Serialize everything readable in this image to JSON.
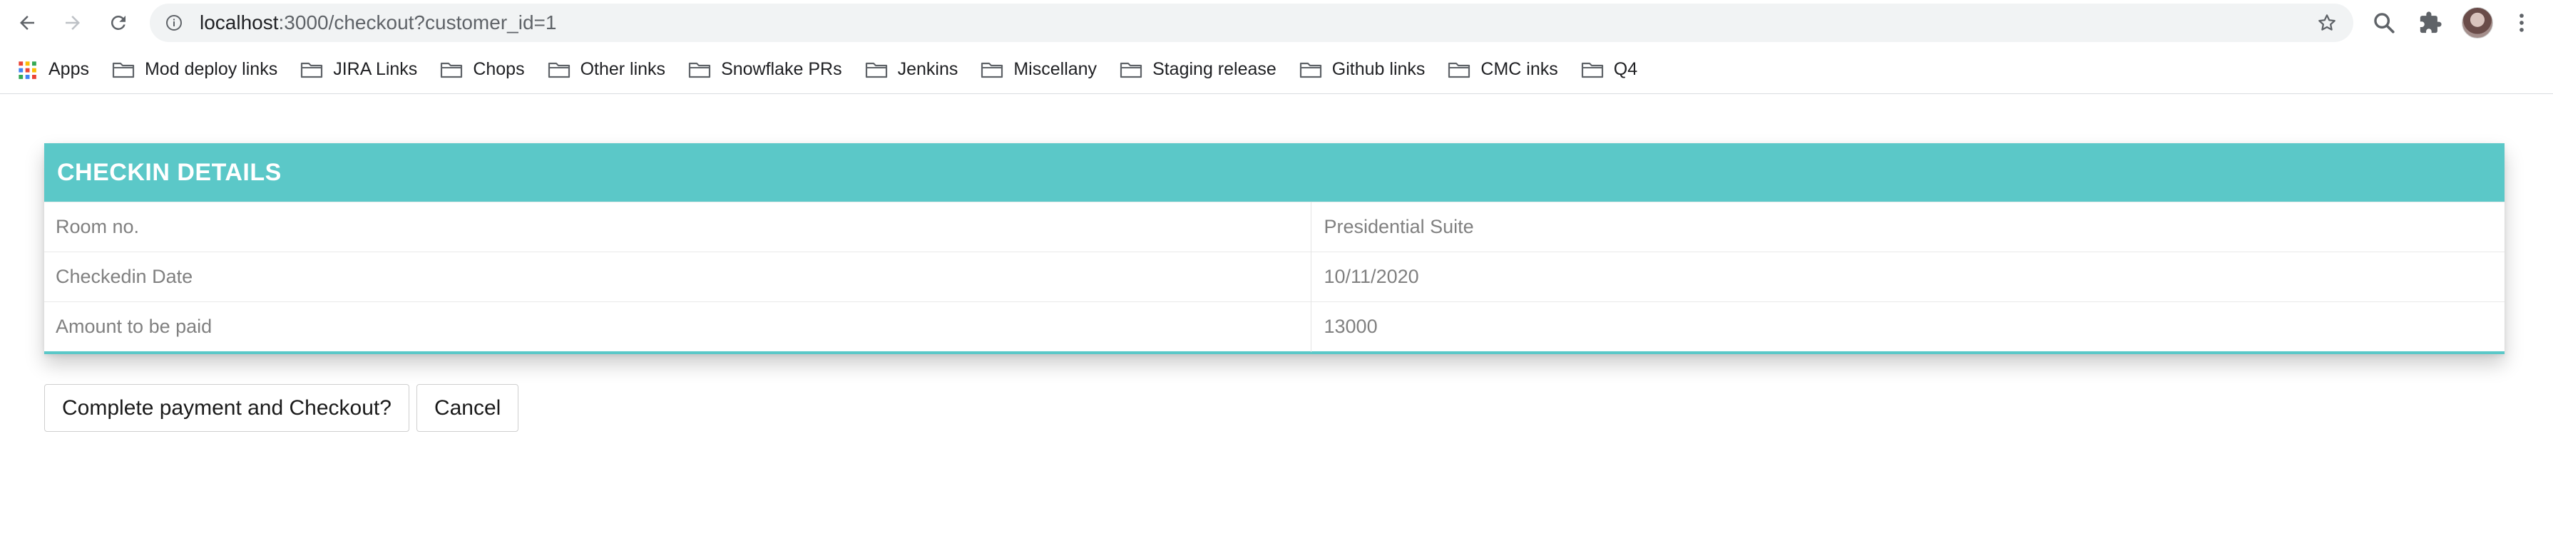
{
  "browser": {
    "url_host": "localhost",
    "url_rest": ":3000/checkout?customer_id=1"
  },
  "bookmarks": [
    {
      "label": "Apps",
      "icon": "apps-grid-icon"
    },
    {
      "label": "Mod deploy links",
      "icon": "folder-icon"
    },
    {
      "label": "JIRA Links",
      "icon": "folder-icon"
    },
    {
      "label": "Chops",
      "icon": "folder-icon"
    },
    {
      "label": "Other links",
      "icon": "folder-icon"
    },
    {
      "label": "Snowflake PRs",
      "icon": "folder-icon"
    },
    {
      "label": "Jenkins",
      "icon": "folder-icon"
    },
    {
      "label": "Miscellany",
      "icon": "folder-icon"
    },
    {
      "label": "Staging release",
      "icon": "folder-icon"
    },
    {
      "label": "Github links",
      "icon": "folder-icon"
    },
    {
      "label": "CMC inks",
      "icon": "folder-icon"
    },
    {
      "label": "Q4",
      "icon": "folder-icon"
    }
  ],
  "checkin": {
    "title": "CHECKIN DETAILS",
    "rows": [
      {
        "label": "Room no.",
        "value": "Presidential Suite"
      },
      {
        "label": "Checkedin Date",
        "value": "10/11/2020"
      },
      {
        "label": "Amount to be paid",
        "value": "13000"
      }
    ]
  },
  "actions": {
    "checkout_label": "Complete payment and Checkout?",
    "cancel_label": "Cancel"
  },
  "colors": {
    "accent": "#5bc8c8",
    "header_text": "#ffffff",
    "cell_text": "#808080"
  }
}
